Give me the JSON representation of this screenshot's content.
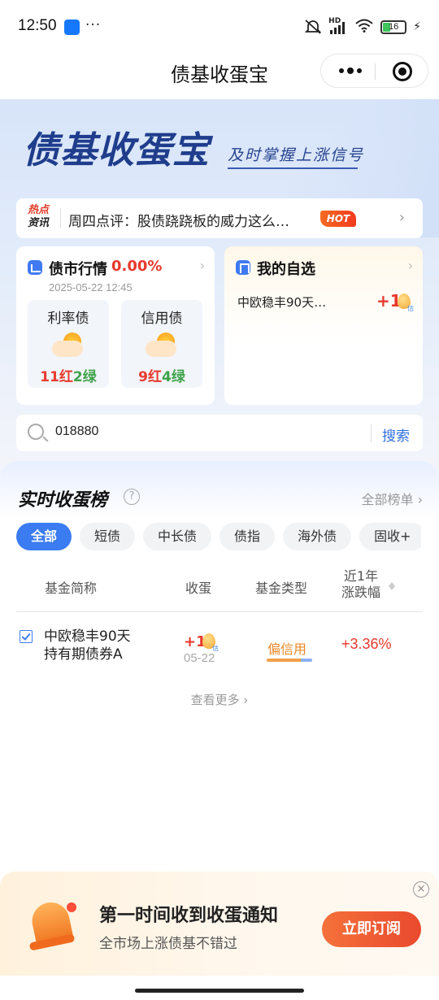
{
  "status_bar": {
    "time": "12:50",
    "battery": "16",
    "hd": "HD"
  },
  "nav": {
    "title": "债基收蛋宝"
  },
  "hero": {
    "logo": "债基收蛋宝",
    "slogan": "及时掌握上涨信号"
  },
  "news": {
    "tag_line1": "热点",
    "tag_line2": "资讯",
    "text": "周四点评：股债跷跷板的威力这么…",
    "hot": "HOT"
  },
  "market_card": {
    "title": "债市行情",
    "change": "0.00%",
    "time": "2025-05-22 12:45",
    "rate_bond": {
      "label": "利率债",
      "red": "11红",
      "green": "2绿"
    },
    "credit_bond": {
      "label": "信用债",
      "red": "9红",
      "green": "4绿"
    }
  },
  "fav_card": {
    "title": "我的自选",
    "fund": "中欧稳丰90天…",
    "value": "+1",
    "est": "估"
  },
  "search": {
    "value": "018880",
    "button": "搜索"
  },
  "ranking": {
    "title": "实时收蛋榜",
    "all_link": "全部榜单",
    "tabs": [
      "全部",
      "短债",
      "中长债",
      "债指",
      "海外债",
      "固收+"
    ],
    "headers": {
      "name": "基金简称",
      "egg": "收蛋",
      "type": "基金类型",
      "chg_line1": "近1年",
      "chg_line2": "涨跌幅"
    },
    "rows": [
      {
        "name_line1": "中欧稳丰90天",
        "name_line2": "持有期债券A",
        "egg": "+1",
        "est": "估",
        "date": "05-22",
        "type": "偏信用",
        "type_credit_share": 0.75,
        "change": "+3.36%"
      }
    ],
    "more": "查看更多"
  },
  "banner": {
    "title": "第一时间收到收蛋通知",
    "subtitle": "全市场上涨债基不错过",
    "button": "立即订阅",
    "close": "×"
  },
  "colors": {
    "accent": "#3b7cf2",
    "red": "#e8392e",
    "green": "#3fa24a",
    "orange": "#e8892a"
  }
}
